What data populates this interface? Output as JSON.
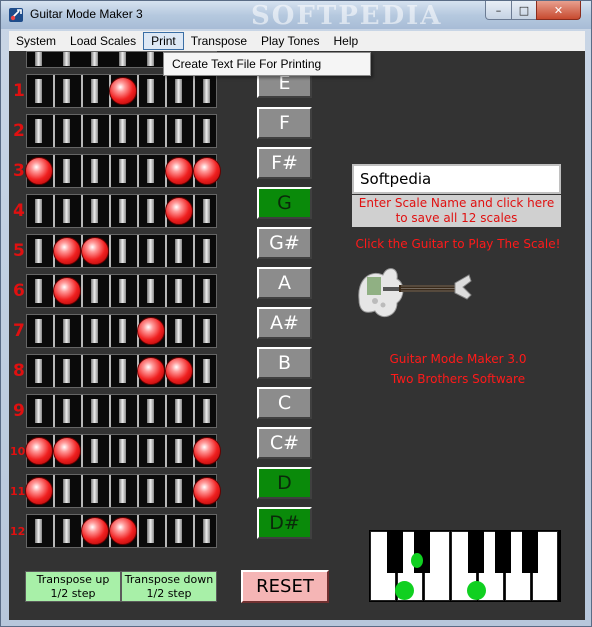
{
  "window": {
    "title": "Guitar Mode Maker 3",
    "watermark": "SOFTPEDIA",
    "min": "–",
    "max": "□",
    "close": "✕"
  },
  "menu": {
    "items": [
      "System",
      "Load Scales",
      "Print",
      "Transpose",
      "Play Tones",
      "Help"
    ],
    "dropdown_item": "Create Text File For Printing"
  },
  "fretboard": {
    "fret_numbers": [
      "1",
      "2",
      "3",
      "4",
      "5",
      "6",
      "7",
      "8",
      "9",
      "10",
      "11",
      "12"
    ],
    "dot_strings": [
      [
        3
      ],
      [],
      [
        0,
        5,
        6
      ],
      [
        5
      ],
      [
        1,
        2
      ],
      [
        1
      ],
      [
        4
      ],
      [
        4,
        5
      ],
      [],
      [
        0,
        1,
        6
      ],
      [
        0,
        6
      ],
      [
        2,
        3
      ]
    ]
  },
  "notes": [
    {
      "label": "E",
      "selected": false
    },
    {
      "label": "F",
      "selected": false
    },
    {
      "label": "F#",
      "selected": false
    },
    {
      "label": "G",
      "selected": true
    },
    {
      "label": "G#",
      "selected": false
    },
    {
      "label": "A",
      "selected": false
    },
    {
      "label": "A#",
      "selected": false
    },
    {
      "label": "B",
      "selected": false
    },
    {
      "label": "C",
      "selected": false
    },
    {
      "label": "C#",
      "selected": false
    },
    {
      "label": "D",
      "selected": true
    },
    {
      "label": "D#",
      "selected": true
    }
  ],
  "scale_name": {
    "value": "Softpedia",
    "hint_line1": "Enter Scale Name and click here",
    "hint_line2": "to save all 12 scales"
  },
  "guitar_hint": "Click the Guitar to Play The Scale!",
  "credits": {
    "line1": "Guitar Mode Maker 3.0",
    "line2": "Two Brothers Software"
  },
  "transpose_up": {
    "line1": "Transpose up",
    "line2": "1/2 step"
  },
  "transpose_down": {
    "line1": "Transpose down",
    "line2": "1/2 step"
  },
  "reset_label": "RESET",
  "colors": {
    "accent_red": "#ff1a1a",
    "selected_green": "#0a8a0a",
    "background": "#333333"
  }
}
